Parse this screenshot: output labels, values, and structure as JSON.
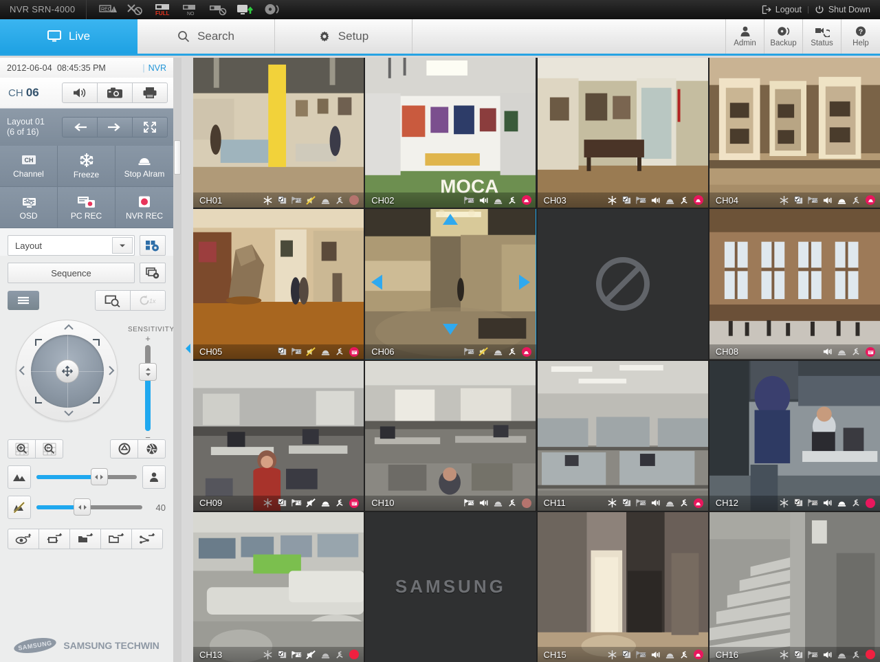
{
  "topbar": {
    "brand": "NVR SRN-4000",
    "status_icons": [
      "rec-warning-icon",
      "network-disconnect-icon",
      "hdd-full-icon",
      "hdd-no-icon",
      "hdd-disabled-icon",
      "monitor-up-icon",
      "disc-icon"
    ],
    "hdd_full_text": "FULL",
    "hdd_no_text": "NO",
    "rec_text": "REC",
    "logout_label": "Logout",
    "separator": "|",
    "shutdown_label": "Shut Down"
  },
  "tabs": {
    "main": [
      {
        "label": "Live",
        "icon": "monitor-icon",
        "active": true
      },
      {
        "label": "Search",
        "icon": "search-icon",
        "active": false
      },
      {
        "label": "Setup",
        "icon": "gear-icon",
        "active": false
      }
    ],
    "right": [
      {
        "label": "Admin",
        "icon": "user-icon"
      },
      {
        "label": "Backup",
        "icon": "disc-icon"
      },
      {
        "label": "Status",
        "icon": "camera-status-icon"
      },
      {
        "label": "Help",
        "icon": "question-icon"
      }
    ]
  },
  "sidebar": {
    "clock": {
      "date": "2012-06-04",
      "time": "08:45:35 PM",
      "source": "NVR",
      "bar": "|"
    },
    "channel": {
      "prefix": "CH",
      "number": "06",
      "buttons": [
        {
          "name": "audio-button",
          "icon": "speaker-icon"
        },
        {
          "name": "snapshot-button",
          "icon": "camera-icon"
        },
        {
          "name": "print-button",
          "icon": "printer-icon"
        }
      ]
    },
    "layout": {
      "title": "Layout 01",
      "subtitle": "(6 of 16)",
      "buttons": [
        {
          "name": "layout-prev-button",
          "icon": "arrow-left-icon"
        },
        {
          "name": "layout-next-button",
          "icon": "arrow-right-icon"
        },
        {
          "name": "fullscreen-button",
          "icon": "expand-icon"
        }
      ]
    },
    "controls": [
      {
        "label": "Channel",
        "icon": "ch-icon"
      },
      {
        "label": "Freeze",
        "icon": "snowflake-icon"
      },
      {
        "label": "Stop Alram",
        "icon": "alarm-bell-icon"
      },
      {
        "label": "OSD",
        "icon": "osd-monitor-icon"
      },
      {
        "label": "PC REC",
        "icon": "pc-rec-icon"
      },
      {
        "label": "NVR REC",
        "icon": "nvr-rec-icon"
      }
    ],
    "layout_select": {
      "value": "Layout",
      "settings_icon": "layout-settings-icon"
    },
    "sequence": {
      "label": "Sequence",
      "settings_icon": "sequence-settings-icon"
    },
    "toolbar": {
      "menu_icon": "hamburger-icon",
      "zoom_search_icon": "digital-zoom-icon",
      "speed_label": "1x",
      "speed_icon": "refresh-icon"
    },
    "ptz": {
      "sensitivity_label": "SENSITIVITY",
      "plus": "+",
      "minus": "−",
      "sensitivity_percent": 71,
      "hub_icon": "move-icon",
      "up_icon": "chevron-up-icon",
      "down_icon": "chevron-down-icon",
      "left_icon": "chevron-left-icon",
      "right_icon": "chevron-right-icon"
    },
    "zoom_buttons": [
      {
        "name": "zoom-in-button",
        "icon": "zoom-in-icon"
      },
      {
        "name": "zoom-out-button",
        "icon": "zoom-out-icon"
      },
      {
        "name": "iris-open-button",
        "icon": "iris-open-icon"
      },
      {
        "name": "iris-close-button",
        "icon": "iris-close-icon"
      }
    ],
    "focus_slider": {
      "left_icon": "focus-far-icon",
      "right_icon": "focus-near-icon",
      "percent": 62
    },
    "value_slider": {
      "left_icon": "auto-focus-icon",
      "percent": 43,
      "value": "40"
    },
    "presets": [
      {
        "name": "preset-view-button",
        "icon": "preset-eye-icon"
      },
      {
        "name": "preset-tour-button",
        "icon": "preset-tour-icon"
      },
      {
        "name": "preset-group-button",
        "icon": "preset-group-icon"
      },
      {
        "name": "preset-pattern-button",
        "icon": "preset-pattern-icon"
      },
      {
        "name": "preset-swing-button",
        "icon": "preset-swing-icon"
      }
    ],
    "logo": {
      "mark": "SAMSUNG",
      "text": "SAMSUNG TECHWIN"
    }
  },
  "grid": {
    "selected_channel": "CH06",
    "channels": [
      {
        "label": "CH01",
        "state": "live",
        "scene": "gallery-yellow-column",
        "icons": [
          "snowflake-icon",
          "copy-check-icon",
          "ptz-icon",
          "audio-mute-icon",
          "alarm-bell-icon",
          "motion-icon"
        ],
        "dot": "#b5746e"
      },
      {
        "label": "CH02",
        "state": "live",
        "scene": "gallery-moca",
        "icons": [
          "ptz-icon",
          "audio-icon",
          "alarm-bell-icon",
          "motion-icon"
        ],
        "dot": "#e8175d",
        "dot_icon": "alarm-active-icon"
      },
      {
        "label": "CH03",
        "state": "live",
        "scene": "gallery-bench",
        "icons": [
          "snowflake-icon",
          "copy-check-icon",
          "ptz-icon",
          "audio-icon",
          "alarm-bell-icon",
          "motion-icon"
        ],
        "dot": "#e8175d",
        "dot_icon": "alarm-active-icon"
      },
      {
        "label": "CH04",
        "state": "live",
        "scene": "gallery-balcony",
        "icons": [
          "snowflake-icon",
          "copy-check-icon",
          "ptz-icon",
          "audio-icon",
          "alarm-bell-icon",
          "motion-icon"
        ],
        "dot": "#e8175d",
        "dot_icon": "alarm-active-icon"
      },
      {
        "label": "CH05",
        "state": "live",
        "scene": "gallery-sculpture",
        "icons": [
          "copy-check-icon",
          "ptz-icon",
          "audio-mute-icon",
          "alarm-bell-icon",
          "motion-icon"
        ],
        "dot": "#e8175d",
        "dot_icon": "calendar-rec-icon"
      },
      {
        "label": "CH06",
        "state": "live",
        "scene": "museum-hall",
        "selected": true,
        "icons": [
          "ptz-icon",
          "audio-mute-icon",
          "alarm-bell-icon",
          "motion-icon"
        ],
        "dot": "#e8175d",
        "dot_icon": "alarm-active-icon"
      },
      {
        "label": "",
        "state": "disabled",
        "scene": "none",
        "icons": []
      },
      {
        "label": "CH08",
        "state": "live",
        "scene": "brick-hall-windows",
        "icons": [
          "audio-icon",
          "alarm-bell-icon",
          "motion-icon"
        ],
        "dot": "#e8175d",
        "dot_icon": "calendar-rec-icon"
      },
      {
        "label": "CH09",
        "state": "live",
        "scene": "office-desks",
        "icons": [
          "snowflake-icon",
          "copy-check-icon",
          "ptz-icon",
          "audio-mute-icon",
          "alarm-bell-icon",
          "motion-icon"
        ],
        "dot": "#e8175d",
        "dot_icon": "calendar-rec-icon"
      },
      {
        "label": "CH10",
        "state": "live",
        "scene": "office-cubicles-wide",
        "icons": [
          "ptz-icon",
          "audio-icon",
          "alarm-bell-icon",
          "motion-icon"
        ],
        "dot": "#b5746e"
      },
      {
        "label": "CH11",
        "state": "live",
        "scene": "office-cubicles",
        "icons": [
          "snowflake-icon",
          "copy-check-icon",
          "ptz-icon",
          "audio-icon",
          "alarm-bell-icon",
          "motion-icon"
        ],
        "dot": "#e8175d",
        "dot_icon": "alarm-active-icon"
      },
      {
        "label": "CH12",
        "state": "live",
        "scene": "office-workers",
        "icons": [
          "snowflake-icon",
          "copy-check-icon",
          "ptz-icon",
          "audio-icon",
          "alarm-bell-icon",
          "motion-icon"
        ],
        "dot": "#e8175d"
      },
      {
        "label": "CH13",
        "state": "live",
        "scene": "parking-garage",
        "icons": [
          "snowflake-icon",
          "copy-check-icon",
          "ptz-icon",
          "audio-mute-icon",
          "alarm-bell-icon",
          "motion-icon"
        ],
        "dot": "#f02040"
      },
      {
        "label": "",
        "state": "logo",
        "scene": "samsung-logo",
        "logo_text": "SAMSUNG",
        "icons": []
      },
      {
        "label": "CH15",
        "state": "live",
        "scene": "door-entry",
        "icons": [
          "snowflake-icon",
          "copy-check-icon",
          "ptz-icon",
          "audio-icon",
          "alarm-bell-icon",
          "motion-icon"
        ],
        "dot": "#e8175d",
        "dot_icon": "alarm-active-icon"
      },
      {
        "label": "CH16",
        "state": "live",
        "scene": "stairwell",
        "icons": [
          "snowflake-icon",
          "copy-check-icon",
          "ptz-icon",
          "audio-icon",
          "alarm-bell-icon",
          "motion-icon"
        ],
        "dot": "#f02040"
      }
    ]
  },
  "colors": {
    "accent": "#1fa8ef",
    "tab_active": "#26a3e3",
    "alarm_red": "#e8175d",
    "sidebar_panel": "#8997a6",
    "topbar_dark": "#1d1d1d"
  }
}
